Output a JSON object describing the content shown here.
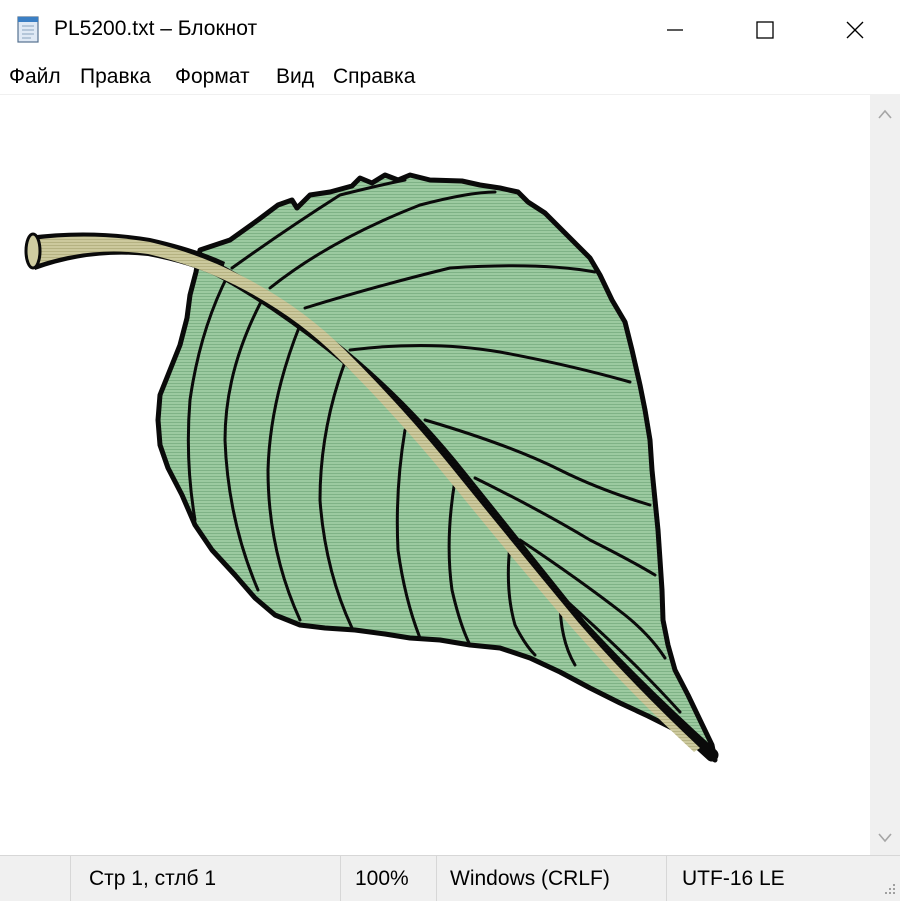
{
  "window": {
    "title": "PL5200.txt – Блокнот"
  },
  "menu": [
    "Файл",
    "Правка",
    "Формат",
    "Вид",
    "Справка"
  ],
  "status": {
    "position": "Стр 1, стлб 1",
    "zoom": "100%",
    "line_ending": "Windows (CRLF)",
    "encoding": "UTF-16 LE"
  },
  "colors": {
    "leaf_fill": "#9ccaa0",
    "outline": "#0a0a0a",
    "stem_fill": "#ccc99d"
  },
  "icons": {
    "app": "notepad-icon",
    "minimize": "minimize-icon",
    "maximize": "maximize-icon",
    "close": "close-icon"
  }
}
